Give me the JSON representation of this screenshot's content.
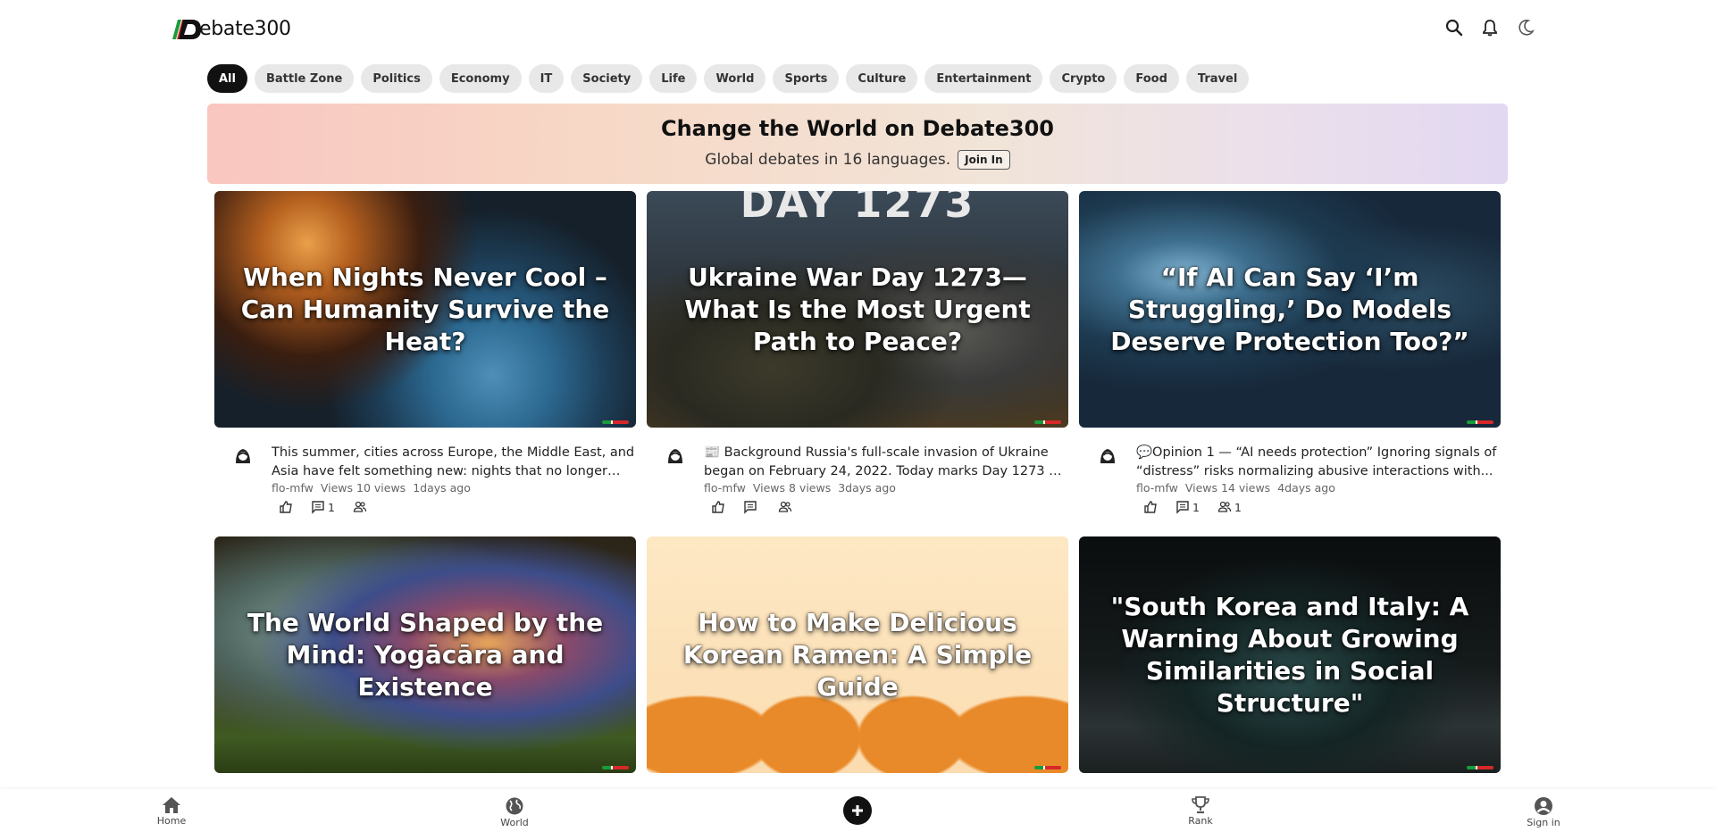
{
  "brand": {
    "logo_text": "ebate300",
    "logo_letter": "D"
  },
  "header_icons": [
    "search-icon",
    "bell-icon",
    "moon-icon"
  ],
  "categories": [
    {
      "label": "All",
      "active": true
    },
    {
      "label": "Battle Zone"
    },
    {
      "label": "Politics"
    },
    {
      "label": "Economy"
    },
    {
      "label": "IT"
    },
    {
      "label": "Society"
    },
    {
      "label": "Life"
    },
    {
      "label": "World"
    },
    {
      "label": "Sports"
    },
    {
      "label": "Culture"
    },
    {
      "label": "Entertainment"
    },
    {
      "label": "Crypto"
    },
    {
      "label": "Food"
    },
    {
      "label": "Travel"
    }
  ],
  "banner": {
    "title": "Change the World on Debate300",
    "subtitle": "Global debates in 16 languages.",
    "join_label": "Join In"
  },
  "cards": [
    {
      "title": "When Nights Never Cool – Can Humanity Survive the Heat?",
      "desc": "This summer, cities across Europe, the Middle East, and Asia have felt something new: nights that no longer cool...",
      "author": "flo-mfw",
      "views": "Views 10 views",
      "time": "1days ago",
      "comments": "1",
      "participants": ""
    },
    {
      "title": "Ukraine War Day 1273—What Is the Most Urgent Path to Peace?",
      "desc": "📰 Background Russia's full-scale invasion of Ukraine began on February 24, 2022. Today marks Day 1273 of a...",
      "author": "flo-mfw",
      "views": "Views 8 views",
      "time": "3days ago",
      "comments": "",
      "participants": "",
      "overlay_text": "DAY 1273"
    },
    {
      "title": "“If AI Can Say ‘I’m Struggling,’ Do Models Deserve Protection Too?”",
      "desc": "💬Opinion 1 — “AI needs protection” Ignoring signals of “distress” risks normalizing abusive interactions with...",
      "author": "flo-mfw",
      "views": "Views 14 views",
      "time": "4days ago",
      "comments": "1",
      "participants": "1"
    },
    {
      "title": "The World Shaped by the Mind: Yogācāra and Existence"
    },
    {
      "title": "How to Make Delicious Korean Ramen: A Simple Guide"
    },
    {
      "title": "\"South Korea and Italy: A Warning About Growing Similarities in Social Structure\""
    }
  ],
  "bottom_nav": {
    "home": "Home",
    "world": "World",
    "rank": "Rank",
    "signin": "Sign in"
  },
  "colors": {
    "accent": "#111111",
    "pill": "#e8e8e8"
  }
}
